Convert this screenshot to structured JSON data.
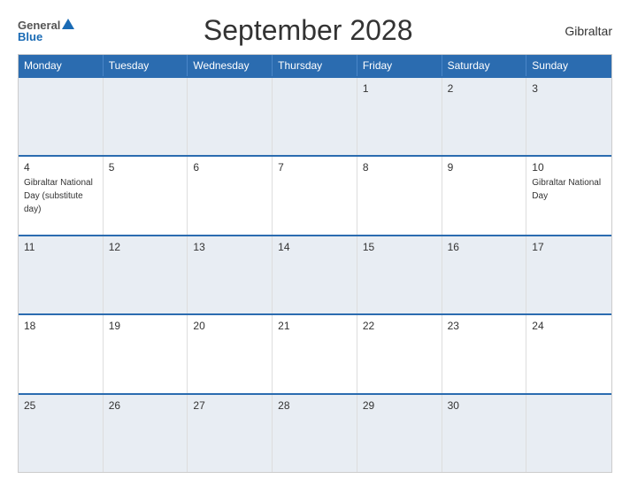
{
  "header": {
    "logo_general": "General",
    "logo_blue": "Blue",
    "title": "September 2028",
    "country": "Gibraltar"
  },
  "days": [
    "Monday",
    "Tuesday",
    "Wednesday",
    "Thursday",
    "Friday",
    "Saturday",
    "Sunday"
  ],
  "weeks": [
    [
      {
        "date": "",
        "event": "",
        "shaded": false
      },
      {
        "date": "",
        "event": "",
        "shaded": false
      },
      {
        "date": "",
        "event": "",
        "shaded": false
      },
      {
        "date": "",
        "event": "",
        "shaded": false
      },
      {
        "date": "1",
        "event": "",
        "shaded": true
      },
      {
        "date": "2",
        "event": "",
        "shaded": false
      },
      {
        "date": "3",
        "event": "",
        "shaded": true
      }
    ],
    [
      {
        "date": "4",
        "event": "Gibraltar National Day (substitute day)",
        "shaded": false
      },
      {
        "date": "5",
        "event": "",
        "shaded": true
      },
      {
        "date": "6",
        "event": "",
        "shaded": false
      },
      {
        "date": "7",
        "event": "",
        "shaded": true
      },
      {
        "date": "8",
        "event": "",
        "shaded": false
      },
      {
        "date": "9",
        "event": "",
        "shaded": true
      },
      {
        "date": "10",
        "event": "Gibraltar National Day",
        "shaded": false
      }
    ],
    [
      {
        "date": "11",
        "event": "",
        "shaded": false
      },
      {
        "date": "12",
        "event": "",
        "shaded": true
      },
      {
        "date": "13",
        "event": "",
        "shaded": false
      },
      {
        "date": "14",
        "event": "",
        "shaded": true
      },
      {
        "date": "15",
        "event": "",
        "shaded": false
      },
      {
        "date": "16",
        "event": "",
        "shaded": true
      },
      {
        "date": "17",
        "event": "",
        "shaded": false
      }
    ],
    [
      {
        "date": "18",
        "event": "",
        "shaded": false
      },
      {
        "date": "19",
        "event": "",
        "shaded": true
      },
      {
        "date": "20",
        "event": "",
        "shaded": false
      },
      {
        "date": "21",
        "event": "",
        "shaded": true
      },
      {
        "date": "22",
        "event": "",
        "shaded": false
      },
      {
        "date": "23",
        "event": "",
        "shaded": true
      },
      {
        "date": "24",
        "event": "",
        "shaded": false
      }
    ],
    [
      {
        "date": "25",
        "event": "",
        "shaded": false
      },
      {
        "date": "26",
        "event": "",
        "shaded": true
      },
      {
        "date": "27",
        "event": "",
        "shaded": false
      },
      {
        "date": "28",
        "event": "",
        "shaded": true
      },
      {
        "date": "29",
        "event": "",
        "shaded": false
      },
      {
        "date": "30",
        "event": "",
        "shaded": true
      },
      {
        "date": "",
        "event": "",
        "shaded": false
      }
    ]
  ]
}
